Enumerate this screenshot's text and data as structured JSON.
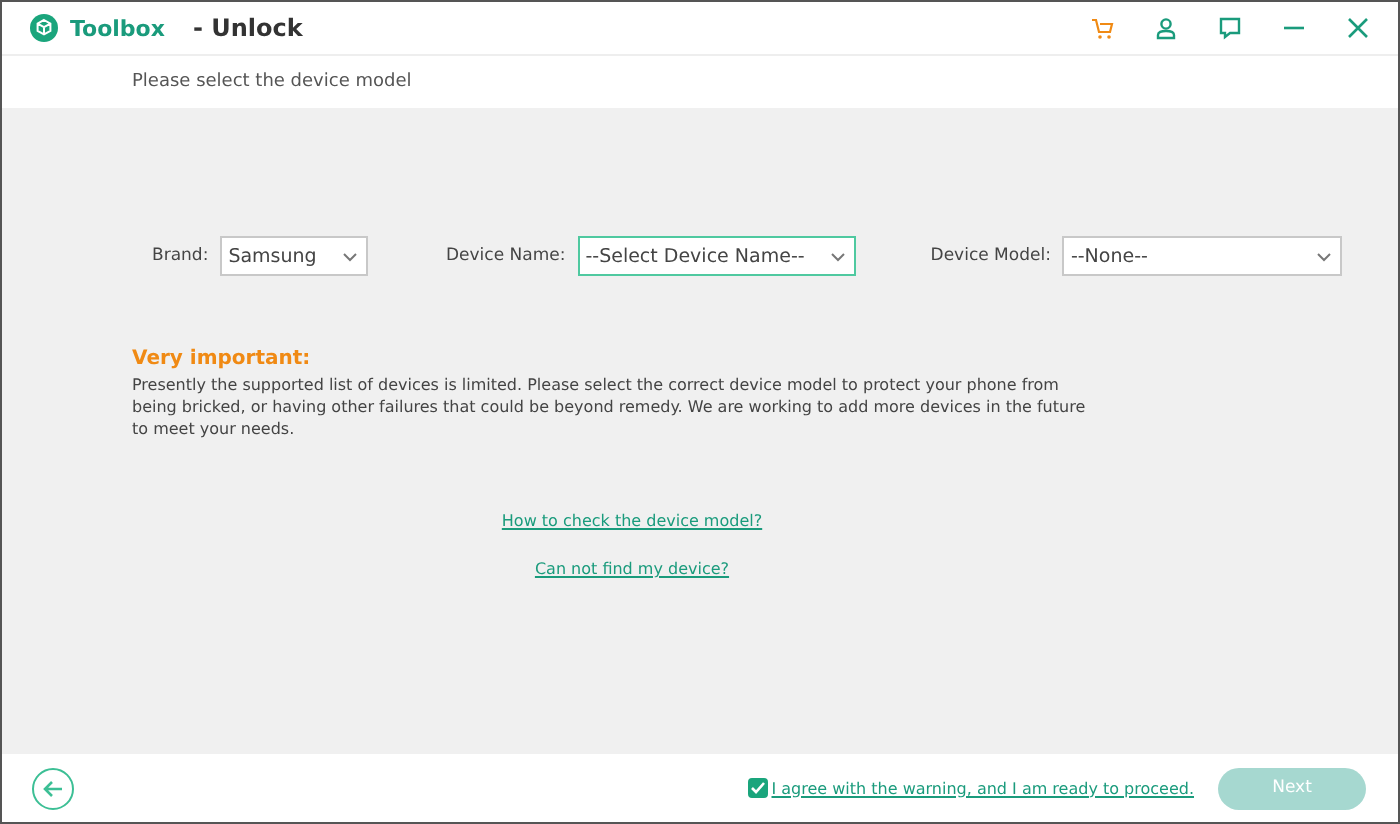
{
  "window": {
    "app": "Toolbox",
    "title": "- Unlock"
  },
  "subtitle": "Please select the device model",
  "selects": [
    {
      "label": "Brand:",
      "value": "Samsung",
      "focused": false
    },
    {
      "label": "Device Name:",
      "value": "--Select Device Name--",
      "focused": true
    },
    {
      "label": "Device Model:",
      "value": "--None--",
      "focused": false
    }
  ],
  "notice": {
    "heading": "Very important:",
    "text": "Presently the supported list of devices is limited. Please select the correct device model to protect your phone from being bricked, or having other failures that could be beyond remedy. We are working to add more devices in the future to meet your needs."
  },
  "links": [
    "How to check the device model?",
    "Can not find my device?"
  ],
  "agree": {
    "label": "I agree with the warning, and I am ready to proceed.",
    "checked": true
  },
  "next": {
    "label": "Next",
    "disabled": true
  }
}
